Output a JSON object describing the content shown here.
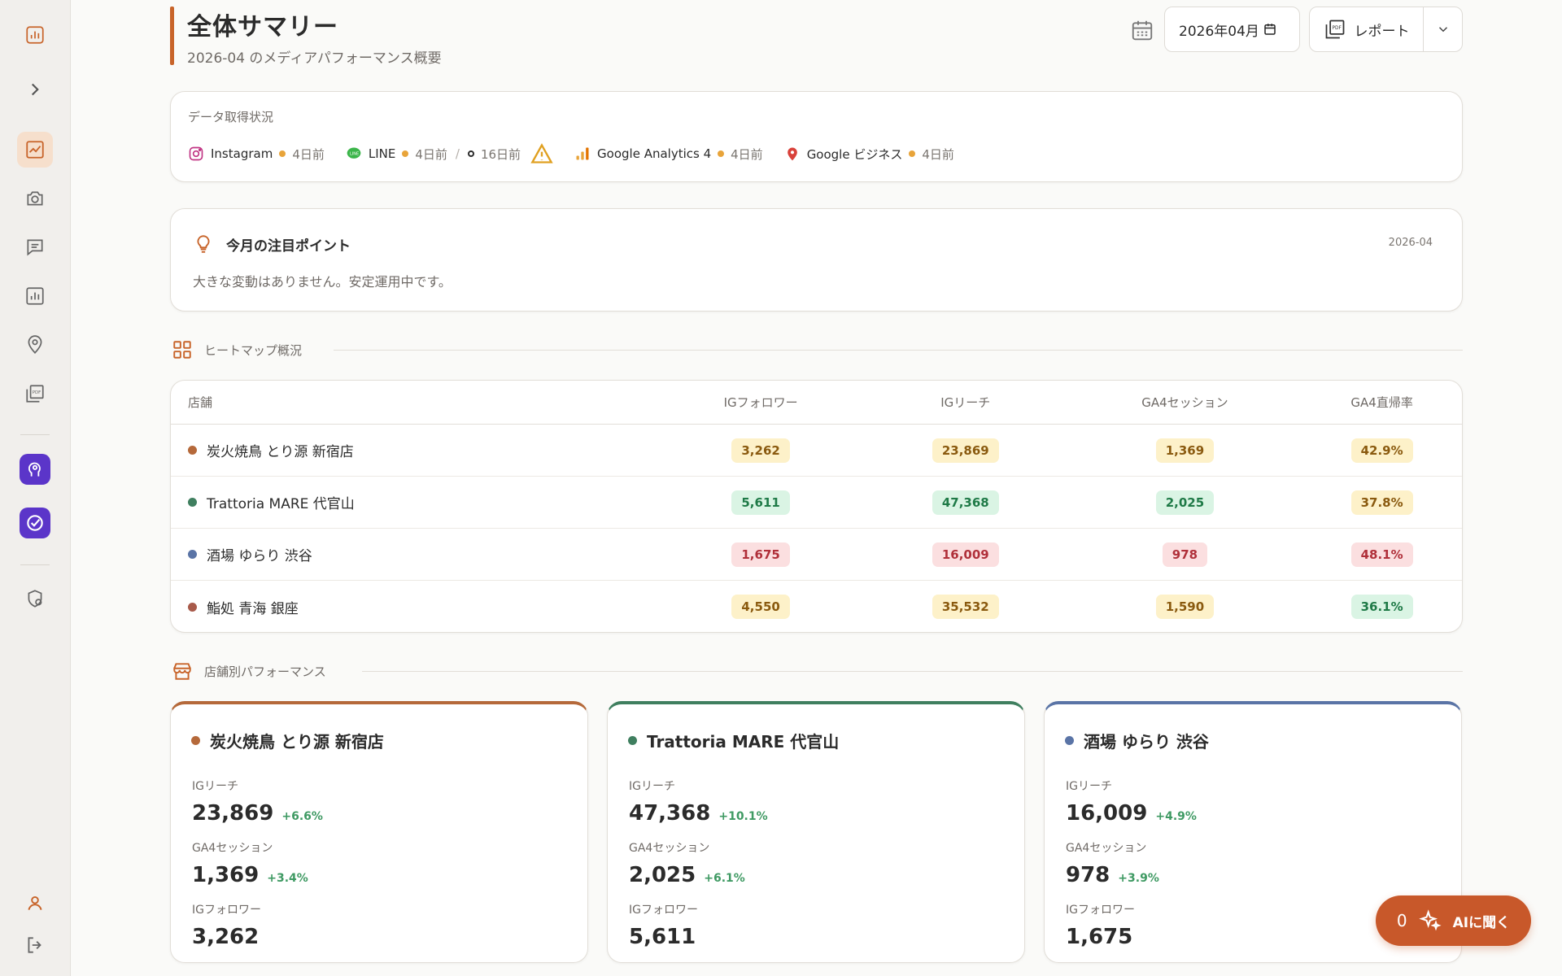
{
  "header": {
    "title": "全体サマリー",
    "subtitle": "2026-04 のメディアパフォーマンス概要",
    "month_value": "2026年04月",
    "report_label": "レポート"
  },
  "status": {
    "label": "データ取得状況",
    "sources": [
      {
        "name": "Instagram",
        "age": "4日前"
      },
      {
        "name": "LINE",
        "age": "4日前",
        "age2": "16日前"
      },
      {
        "name": "Google Analytics 4",
        "age": "4日前"
      },
      {
        "name": "Google ビジネス",
        "age": "4日前"
      }
    ]
  },
  "focus": {
    "title": "今月の注目ポイント",
    "date": "2026-04",
    "text": "大きな変動はありません。安定運用中です。"
  },
  "heatmap": {
    "section_title": "ヒートマップ概況",
    "columns": [
      "店舗",
      "IGフォロワー",
      "IGリーチ",
      "GA4セッション",
      "GA4直帰率"
    ],
    "rows": [
      {
        "store": "炭火焼鳥 とり源 新宿店",
        "color": "#b5693a",
        "values": [
          "3,262",
          "23,869",
          "1,369",
          "42.9%"
        ],
        "levels": [
          "y",
          "y",
          "y",
          "y"
        ]
      },
      {
        "store": "Trattoria MARE 代官山",
        "color": "#3f7f5f",
        "values": [
          "5,611",
          "47,368",
          "2,025",
          "37.8%"
        ],
        "levels": [
          "g",
          "g",
          "g",
          "y"
        ]
      },
      {
        "store": "酒場 ゆらり 渋谷",
        "color": "#5a74a6",
        "values": [
          "1,675",
          "16,009",
          "978",
          "48.1%"
        ],
        "levels": [
          "r",
          "r",
          "r",
          "r"
        ]
      },
      {
        "store": "鮨処 青海 銀座",
        "color": "#a85a4a",
        "values": [
          "4,550",
          "35,532",
          "1,590",
          "36.1%"
        ],
        "levels": [
          "y",
          "y",
          "y",
          "g"
        ]
      }
    ]
  },
  "performance": {
    "section_title": "店舗別パフォーマンス",
    "stores": [
      {
        "name": "炭火焼鳥 とり源 新宿店",
        "color": "#b5693a",
        "metrics": [
          {
            "label": "IGリーチ",
            "value": "23,869",
            "delta": "+6.6%"
          },
          {
            "label": "GA4セッション",
            "value": "1,369",
            "delta": "+3.4%"
          },
          {
            "label": "IGフォロワー",
            "value": "3,262",
            "delta": ""
          }
        ]
      },
      {
        "name": "Trattoria MARE 代官山",
        "color": "#3f7f5f",
        "metrics": [
          {
            "label": "IGリーチ",
            "value": "47,368",
            "delta": "+10.1%"
          },
          {
            "label": "GA4セッション",
            "value": "2,025",
            "delta": "+6.1%"
          },
          {
            "label": "IGフォロワー",
            "value": "5,611",
            "delta": ""
          }
        ]
      },
      {
        "name": "酒場 ゆらり 渋谷",
        "color": "#5a74a6",
        "metrics": [
          {
            "label": "IGリーチ",
            "value": "16,009",
            "delta": "+4.9%"
          },
          {
            "label": "GA4セッション",
            "value": "978",
            "delta": "+3.9%"
          },
          {
            "label": "IGフォロワー",
            "value": "1,675",
            "delta": ""
          }
        ]
      }
    ]
  },
  "ai": {
    "count": "0",
    "label": "AIに聞く"
  },
  "colors": {
    "accent": "#c8642a",
    "sidebar_active": "#f6dfcc",
    "purple": "#5b35c9"
  }
}
